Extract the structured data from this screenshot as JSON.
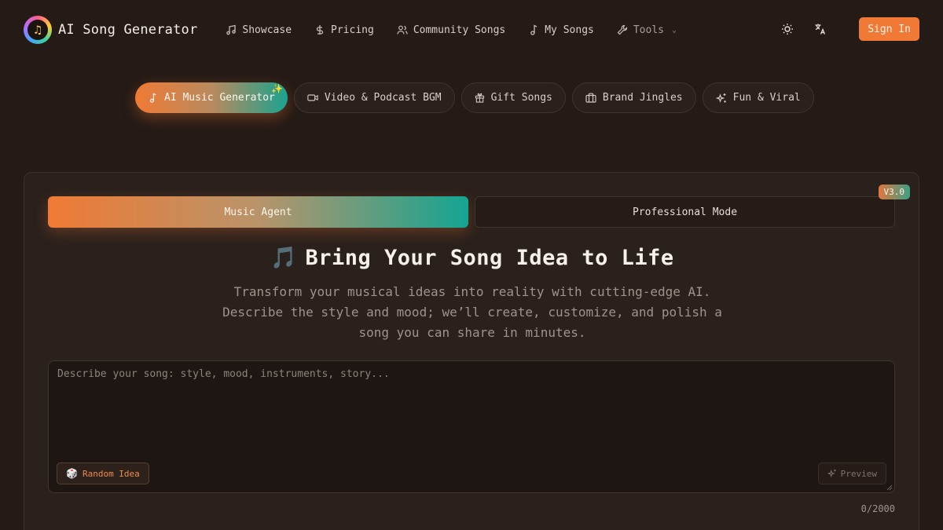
{
  "header": {
    "logo_text": "AI Song Generator",
    "nav": [
      {
        "label": "Showcase",
        "icon": "music-note-icon"
      },
      {
        "label": "Pricing",
        "icon": "dollar-icon"
      },
      {
        "label": "Community Songs",
        "icon": "users-icon"
      },
      {
        "label": "My Songs",
        "icon": "music-note-icon"
      },
      {
        "label": "Tools",
        "icon": "wrench-icon"
      }
    ],
    "sign_in": "Sign In"
  },
  "categories": [
    {
      "label": "AI Music Generator",
      "icon": "music-note-icon",
      "active": true
    },
    {
      "label": "Video & Podcast BGM",
      "icon": "video-icon"
    },
    {
      "label": "Gift Songs",
      "icon": "gift-icon"
    },
    {
      "label": "Brand Jingles",
      "icon": "briefcase-icon"
    },
    {
      "label": "Fun & Viral",
      "icon": "sparkles-icon"
    }
  ],
  "card": {
    "tabs": {
      "agent": "Music Agent",
      "pro": "Professional Mode"
    },
    "version_badge": "V3.0",
    "title_emoji": "🎵",
    "title": "Bring Your Song Idea to Life",
    "subtitle": "Transform your musical ideas into reality with cutting-edge AI. Describe the style and mood; we’ll create, customize, and polish a song you can share in minutes.",
    "input": {
      "placeholder": "Describe your song: style, mood, instruments, story...",
      "value": ""
    },
    "random_idea": "Random Idea",
    "preview": "Preview",
    "char_count": "0/2000"
  },
  "colors": {
    "accent": "#f07a35",
    "teal": "#14a592",
    "background": "#241a16"
  }
}
